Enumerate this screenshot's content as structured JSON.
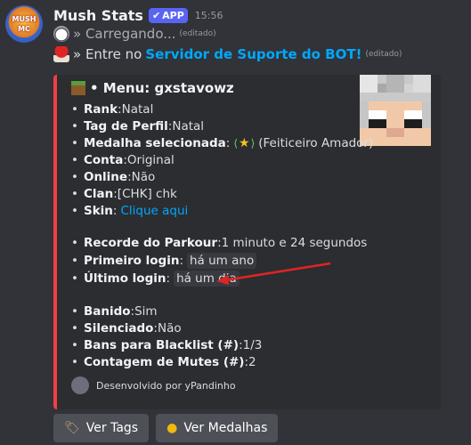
{
  "bot": {
    "avatar_text_line1": "MUSH",
    "avatar_text_line2": "MC",
    "username": "Mush Stats",
    "badge": "APP",
    "timestamp": "15:56"
  },
  "messages": [
    {
      "icon": "alarm-clock-icon",
      "text": "» Carregando...",
      "edited": "(editado)"
    },
    {
      "icon": "mushroom-icon",
      "text": "» Entre no",
      "link": "Servidor de Suporte do BOT!",
      "edited": "(editado)"
    }
  ],
  "embed": {
    "accent_color": "#f23f43",
    "title": "• Menu: gxstavowz",
    "fields": [
      {
        "label": "Rank",
        "sep": ": ",
        "value": "Natal"
      },
      {
        "label": "Tag de Perfil",
        "sep": ": ",
        "value": "Natal"
      },
      {
        "label": "Medalha selecionada",
        "sep": ": ",
        "value": "(Feiticeiro Amador)"
      },
      {
        "label": "Conta",
        "sep": ": ",
        "value": "Original"
      },
      {
        "label": "Online",
        "sep": ": ",
        "value": "Não"
      },
      {
        "label": "Clan",
        "sep": ": ",
        "value": "[CHK] chk"
      },
      {
        "label": "Skin",
        "sep": ": ",
        "link": "Clique aqui"
      },
      {
        "label": "Recorde do Parkour",
        "sep": ": ",
        "value": "1 minuto e 24 segundos"
      },
      {
        "label": "Primeiro login",
        "sep": ": ",
        "code": "há um ano"
      },
      {
        "label": "Último login",
        "sep": ": ",
        "code": "há um dia"
      },
      {
        "label": "Banido",
        "sep": ": ",
        "value": "Sim"
      },
      {
        "label": "Silenciado",
        "sep": ": ",
        "value": "Não"
      },
      {
        "label": "Bans para Blacklist (#)",
        "sep": ": ",
        "value": "1/3"
      },
      {
        "label": "Contagem de Mutes (#)",
        "sep": ": ",
        "value": "2"
      }
    ],
    "footer": "Desenvolvido por yPandinho"
  },
  "buttons": [
    {
      "label": "Ver Tags",
      "icon": "tag-icon"
    },
    {
      "label": "Ver Medalhas",
      "icon": "medal-icon"
    }
  ],
  "annotation_color": "#e02424"
}
